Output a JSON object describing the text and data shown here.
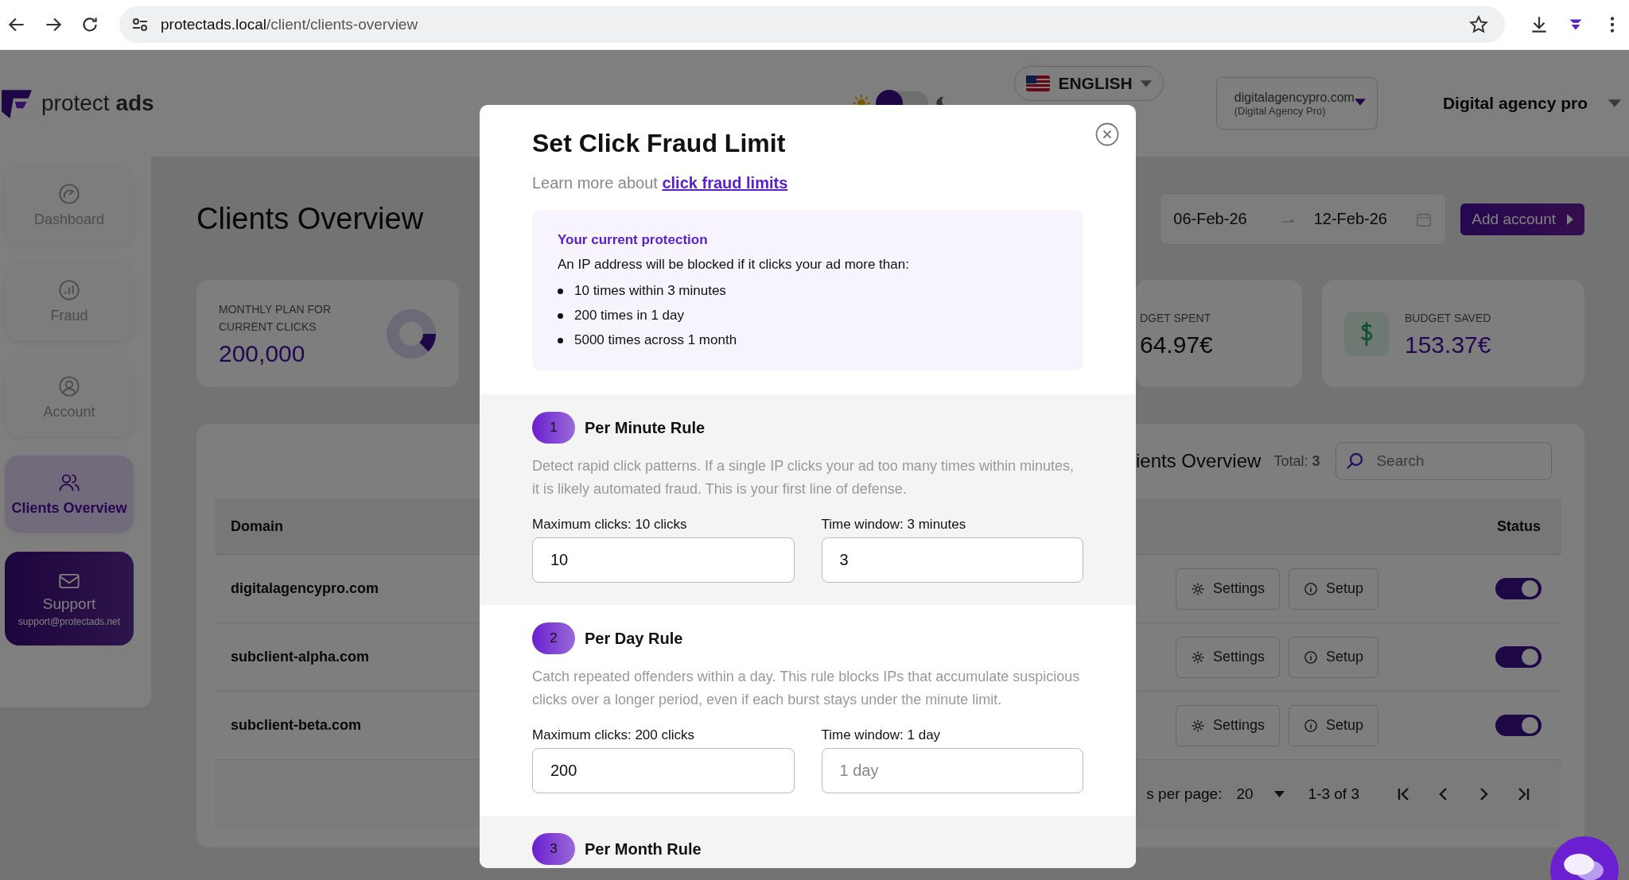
{
  "browser": {
    "url_host": "protectads.local",
    "url_path": "/client/clients-overview"
  },
  "header": {
    "logo": "protect **ads**",
    "theme_toggle_on": false,
    "language": "ENGLISH",
    "account": {
      "domain": "digitalagencypro.com",
      "name": "(Digital Agency Pro)"
    },
    "user": "Digital agency pro"
  },
  "sidebar": {
    "items": [
      {
        "label": "Dashboard",
        "selected": false
      },
      {
        "label": "Fraud",
        "selected": false
      },
      {
        "label": "Account",
        "selected": false
      },
      {
        "label": "Clients Overview",
        "selected": true
      }
    ],
    "support": {
      "label": "Support",
      "email": "support@protectads.net"
    }
  },
  "page": {
    "title": "Clients Overview",
    "date_from": "06-Feb-26",
    "date_to": "12-Feb-26",
    "add_button": "Add account"
  },
  "stats": [
    {
      "kind": "donut",
      "label": "MONTHLY PLAN FOR CURRENT CLICKS",
      "value": "200,000"
    },
    {
      "kind": "plain",
      "label": "DGET SPENT",
      "value": "64.97€"
    },
    {
      "kind": "money",
      "label": "BUDGET SAVED",
      "value": "153.37€"
    }
  ],
  "table": {
    "title": "ients Overview",
    "total": "Total: **3**",
    "search_placeholder": "Search",
    "columns": [
      "Domain",
      "Status"
    ],
    "rows": [
      {
        "domain": "digitalagencypro.com",
        "settings": "Settings",
        "setup": "Setup",
        "on": true
      },
      {
        "domain": "subclient-alpha.com",
        "settings": "Settings",
        "setup": "Setup",
        "on": true
      },
      {
        "domain": "subclient-beta.com",
        "settings": "Settings",
        "setup": "Setup",
        "on": true
      }
    ],
    "footer": {
      "rows_per_page_label": "s per page:",
      "rows_per_page": "20",
      "range": "1-3 of 3"
    }
  },
  "modal": {
    "title": "Set Click Fraud Limit",
    "intro": "Learn more about",
    "link": "click fraud limits",
    "protection": {
      "heading": "Your current protection",
      "text": "An IP address will be blocked if it clicks your ad more than:",
      "items": [
        "10 times within 3 minutes",
        "200 times in 1 day",
        "5000 times across 1 month"
      ]
    },
    "rules": [
      {
        "number": "1",
        "title": "Per Minute Rule",
        "description": "Detect rapid click patterns. If a single IP clicks your ad too many times within minutes, it is likely automated fraud. This is your first line of defense.",
        "fields": [
          {
            "label": "Maximum clicks: 10 clicks",
            "value": "10"
          },
          {
            "label": "Time window: 3 minutes",
            "value": "3"
          }
        ]
      },
      {
        "number": "2",
        "title": "Per Day Rule",
        "description": "Catch repeated offenders within a day. This rule blocks IPs that accumulate suspicious clicks over a longer period, even if each burst stays under the minute limit.",
        "fields": [
          {
            "label": "Maximum clicks: 200 clicks",
            "value": "200"
          },
          {
            "label": "Time window: 1 day",
            "placeholder": "1 day"
          }
        ]
      },
      {
        "number": "3",
        "title": "Per Month Rule"
      }
    ]
  }
}
